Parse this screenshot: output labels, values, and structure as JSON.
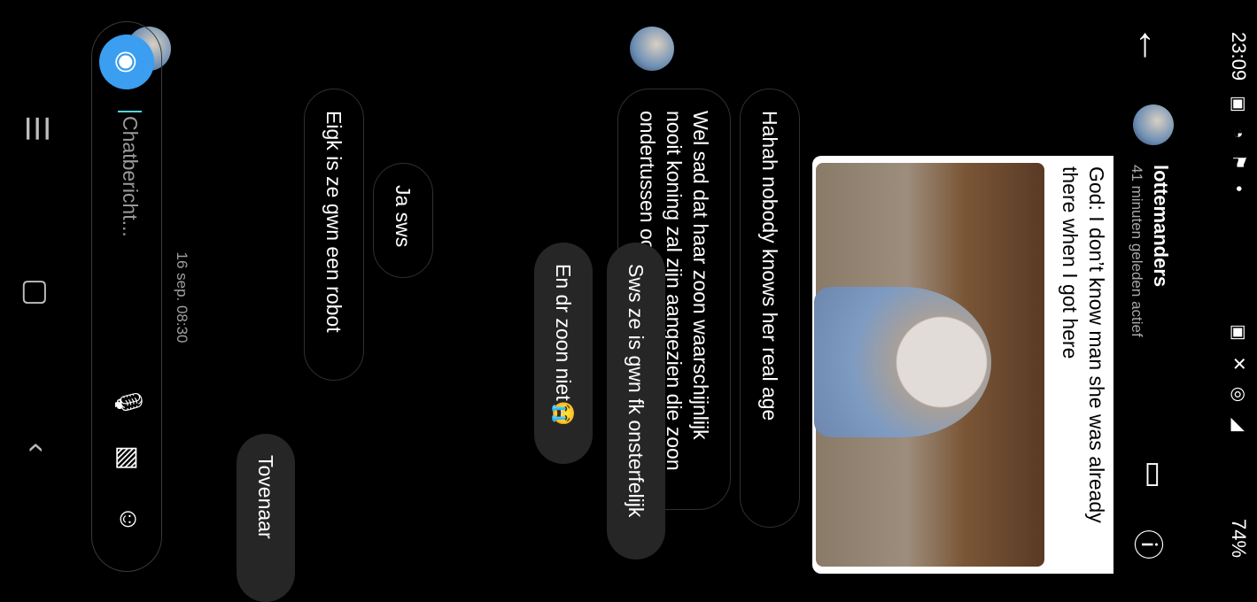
{
  "status_bar": {
    "time": "23:09",
    "left_icons": "▣ ◔ ⚑ •",
    "right_icons": "▣ ✕ ◎ ◢",
    "battery": "74%"
  },
  "header": {
    "back_icon": "←",
    "contact_name": "lottemanders",
    "contact_status": "41 minuten geleden actief",
    "video_icon": "▭",
    "info_icon": "ⓘ"
  },
  "meme": {
    "caption": "God: I don’t know man she was already there when I got here"
  },
  "messages": [
    {
      "text": "Hahah nobody knows her real age",
      "side": "received"
    },
    {
      "text": "Wel sad dat haar zoon waarschijnlijk nooit koning zal zijn aangezien die zoon ondertussen ook al bejaard is 😂",
      "side": "received"
    },
    {
      "text": "Sws ze is gwn fk onsterfelijk",
      "side": "sent"
    },
    {
      "text": "En dr zoon niet😭",
      "side": "sent"
    },
    {
      "text": "Ja sws",
      "side": "received"
    },
    {
      "text": "Eigk is ze gwn een robot",
      "side": "received"
    },
    {
      "text": "Tovenaar",
      "side": "sent"
    }
  ],
  "timestamp": "16 sep. 08:30",
  "input": {
    "placeholder": "Chatbericht...",
    "camera_icon": "◉",
    "mic_icon": "🎙",
    "gallery_icon": "▧",
    "sticker_icon": "☺"
  },
  "nav": {
    "menu_icon": "☰",
    "home_icon": "▢",
    "back_icon": "‹"
  }
}
